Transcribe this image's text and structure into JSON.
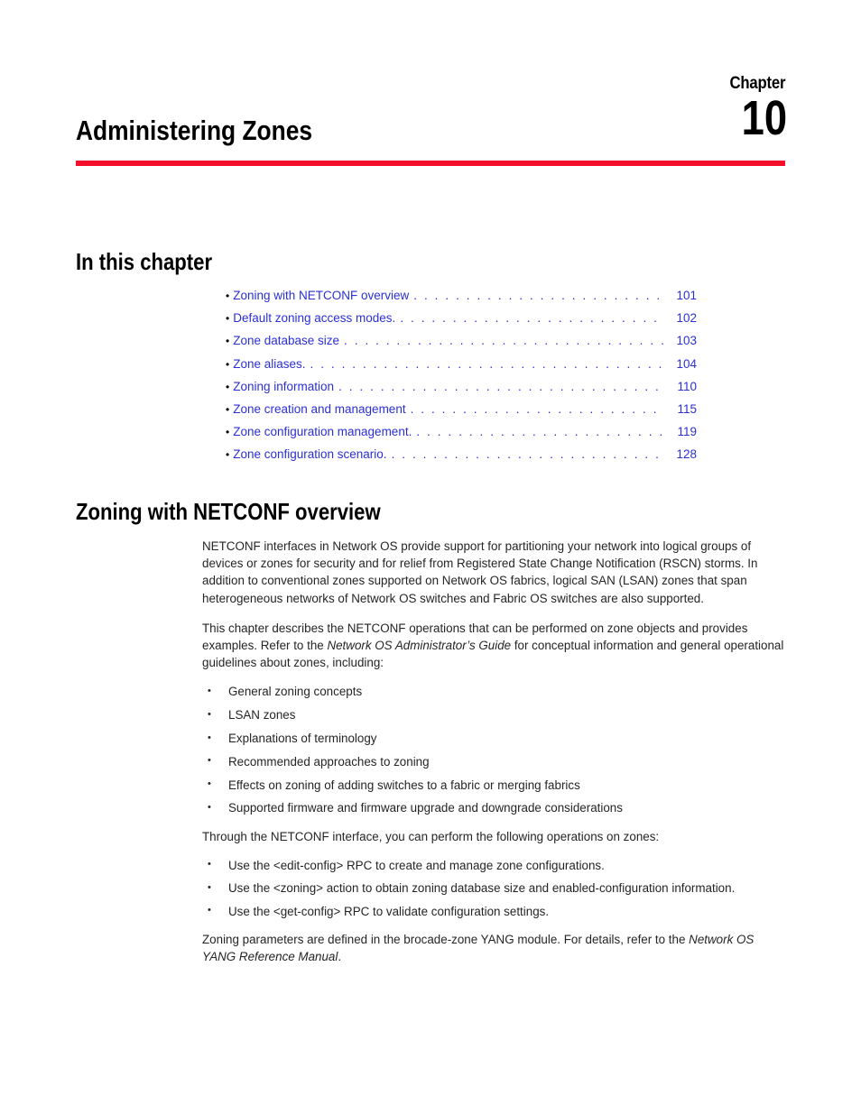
{
  "chapter": {
    "label": "Chapter",
    "number": "10",
    "title": "Administering Zones",
    "rule_color": "#f4102a"
  },
  "toc": {
    "heading": "In this chapter",
    "link_color": "#2b2fd5",
    "entries": [
      {
        "title": "Zoning with NETCONF overview",
        "page": "101"
      },
      {
        "title": "Default zoning access modes.",
        "page": "102"
      },
      {
        "title": "Zone database size",
        "page": "103"
      },
      {
        "title": "Zone aliases.",
        "page": "104"
      },
      {
        "title": "Zoning information",
        "page": "110"
      },
      {
        "title": "Zone creation and management",
        "page": "115"
      },
      {
        "title": "Zone configuration management.",
        "page": "119"
      },
      {
        "title": "Zone configuration scenario.",
        "page": "128"
      }
    ],
    "leader_dots": ". . . . . . . . . . . . . . . . . . . . . . . . . . . . . . . . . . . . . . . . . . . . . . . . . . . . . . . . . . . . . . . . . . . . . . . . . . . . . . . . . . . . . . . . . . ."
  },
  "section": {
    "heading": "Zoning with NETCONF overview",
    "paragraph_1": "NETCONF interfaces in Network OS provide support for partitioning your network into logical groups of devices or zones for security and for relief from Registered State Change Notification (RSCN) storms. In addition to conventional zones supported on Network OS fabrics, logical SAN (LSAN) zones that span heterogeneous networks of Network OS switches and Fabric OS switches are also supported.",
    "paragraph_2_part_1": "This chapter describes the NETCONF operations that can be performed on zone objects and provides examples. Refer to the ",
    "paragraph_2_italic": "Network OS Administrator’s Guide",
    "paragraph_2_part_2": " for conceptual information and general operational guidelines about zones, including:",
    "concepts_list": [
      "General zoning concepts",
      "LSAN zones",
      "Explanations of terminology",
      "Recommended approaches to zoning",
      "Effects on zoning of adding switches to a fabric or merging fabrics",
      "Supported firmware and firmware upgrade and downgrade considerations"
    ],
    "paragraph_3": "Through the NETCONF interface, you can perform the following operations on zones:",
    "operations_list": [
      "Use the <edit-config> RPC to create and manage zone configurations.",
      "Use the <zoning> action to obtain zoning database size and enabled-configuration information.",
      "Use the <get-config> RPC to validate configuration settings."
    ],
    "paragraph_4_part_1": "Zoning parameters are defined in the brocade-zone YANG module. For details, refer to the ",
    "paragraph_4_italic": "Network OS YANG Reference Manual",
    "paragraph_4_part_2": "."
  }
}
